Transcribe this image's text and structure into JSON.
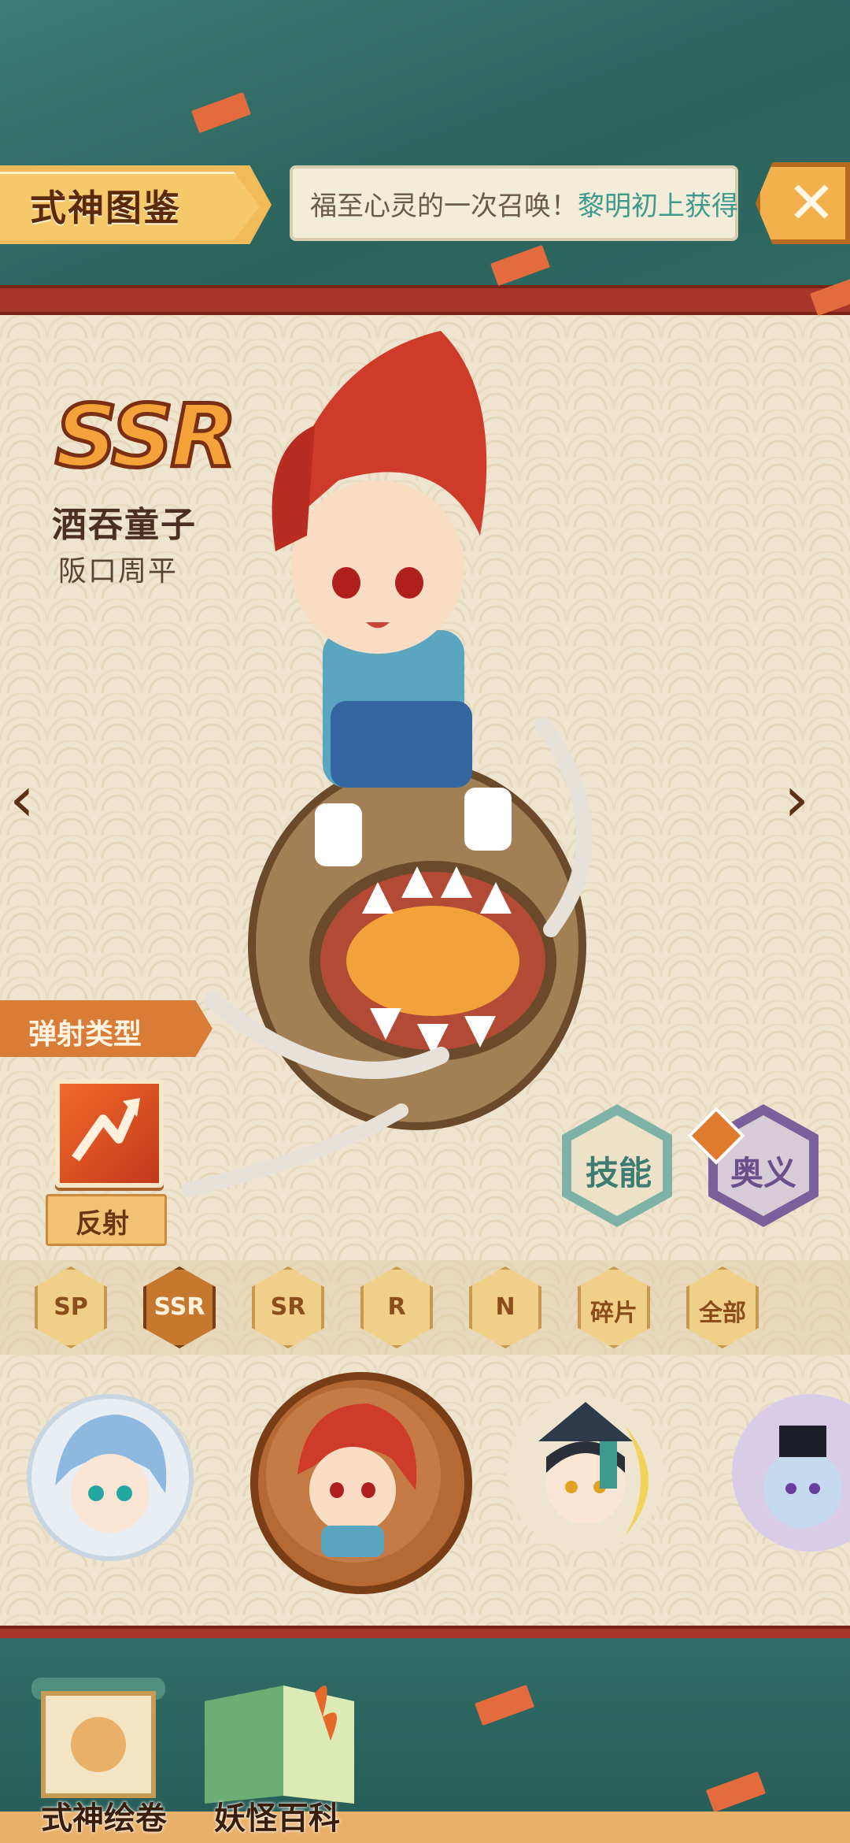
{
  "header": {
    "title": "式神图鉴",
    "marquee_prefix": "福至心灵的一次召唤！",
    "marquee_highlight": "黎明初上获得",
    "close_glyph": "✕"
  },
  "hero": {
    "rarity": "SSR",
    "name": "酒吞童子",
    "cv": "阪口周平",
    "prev_glyph": "‹",
    "next_glyph": "›"
  },
  "shooter": {
    "section_label": "弹射类型",
    "type_name": "反射",
    "icon": "bounce-arrow-icon"
  },
  "actions": {
    "skill": "技能",
    "ougi": "奥义",
    "ougi_locked": true
  },
  "filters": [
    {
      "label": "SP",
      "selected": false
    },
    {
      "label": "SSR",
      "selected": true
    },
    {
      "label": "SR",
      "selected": false
    },
    {
      "label": "R",
      "selected": false
    },
    {
      "label": "N",
      "selected": false
    },
    {
      "label": "碎片",
      "selected": false
    },
    {
      "label": "全部",
      "selected": false
    }
  ],
  "characters": [
    {
      "id": "blue-hair-shikigami",
      "selected": false
    },
    {
      "id": "shuten-doji",
      "selected": true
    },
    {
      "id": "dark-hat-shikigami",
      "selected": false
    },
    {
      "id": "purple-shikigami",
      "selected": false
    }
  ],
  "bottom_nav": {
    "scroll_label": "式神绘卷",
    "encyclopedia_label": "妖怪百科"
  },
  "colors": {
    "accent_orange": "#f1bb5a",
    "red_band": "#a8352b",
    "teal_bg": "#2e6a63",
    "panel": "#efe4cf"
  }
}
